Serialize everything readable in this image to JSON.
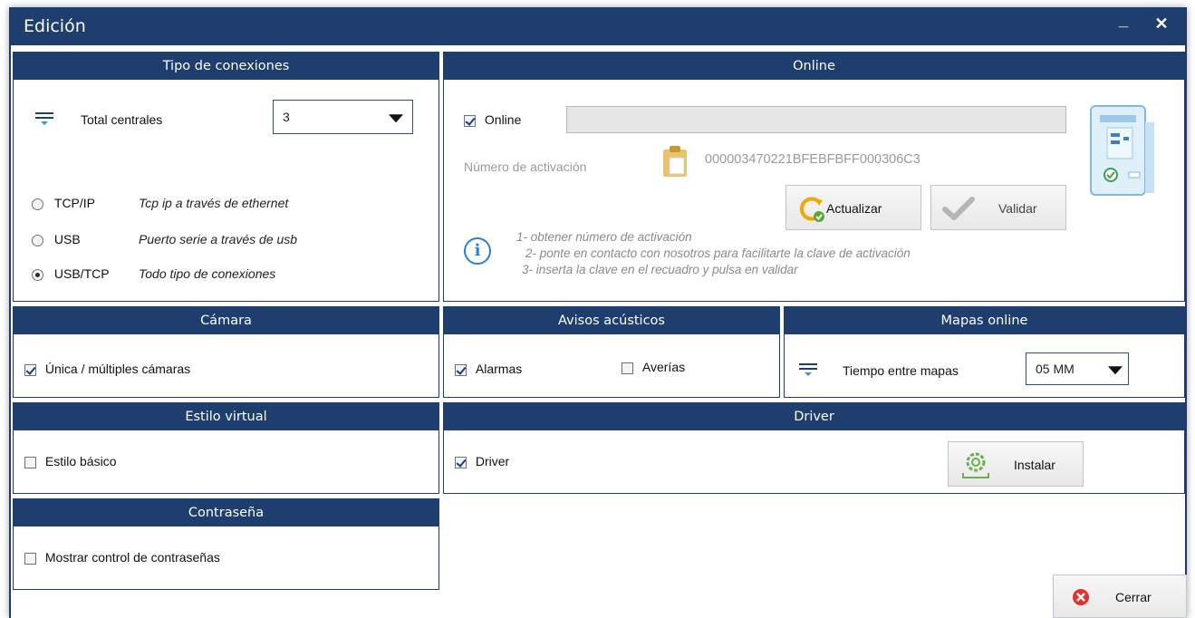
{
  "window": {
    "title": "Edición",
    "minimize_label": "_",
    "close_label": "✕"
  },
  "conexiones": {
    "header": "Tipo de conexiones",
    "total_label": "Total centrales",
    "total_value": "3",
    "options": [
      {
        "label": "TCP/IP",
        "desc": "Tcp ip a través de ethernet",
        "selected": false
      },
      {
        "label": "USB",
        "desc": "Puerto serie a través de usb",
        "selected": false
      },
      {
        "label": "USB/TCP",
        "desc": "Todo tipo de conexiones",
        "selected": true
      }
    ]
  },
  "online": {
    "header": "Online",
    "checkbox_label": "Online",
    "checked": true,
    "field_value": "",
    "activation_label": "Número de activación",
    "activation_number": "000003470221BFEBFBFF000306C3",
    "actualizar_label": "Actualizar",
    "validar_label": "Validar",
    "steps": [
      "1- obtener número de activación",
      "2- ponte en contacto con nosotros para facilitarte la clave de activación",
      "3- inserta la clave en el recuadro y pulsa en validar"
    ]
  },
  "camara": {
    "header": "Cámara",
    "checkbox_label": "Única / múltiples cámaras",
    "checked": true
  },
  "avisos": {
    "header": "Avisos acústicos",
    "alarmas_label": "Alarmas",
    "alarmas_checked": true,
    "averias_label": "Averías",
    "averias_checked": false
  },
  "mapas": {
    "header": "Mapas online",
    "tiempo_label": "Tiempo entre mapas",
    "tiempo_value": "05 MM"
  },
  "estilo": {
    "header": "Estilo virtual",
    "checkbox_label": "Estilo básico",
    "checked": false
  },
  "driver": {
    "header": "Driver",
    "checkbox_label": "Driver",
    "checked": true,
    "instalar_label": "Instalar"
  },
  "contrasena": {
    "header": "Contraseña",
    "checkbox_label": "Mostrar control de contraseñas",
    "checked": false
  },
  "footer": {
    "cerrar_label": "Cerrar"
  },
  "colors": {
    "header_bg": "#1f3e70",
    "accent": "#2a7fd4",
    "close_red": "#e03030",
    "check_green": "#6ab04c"
  }
}
